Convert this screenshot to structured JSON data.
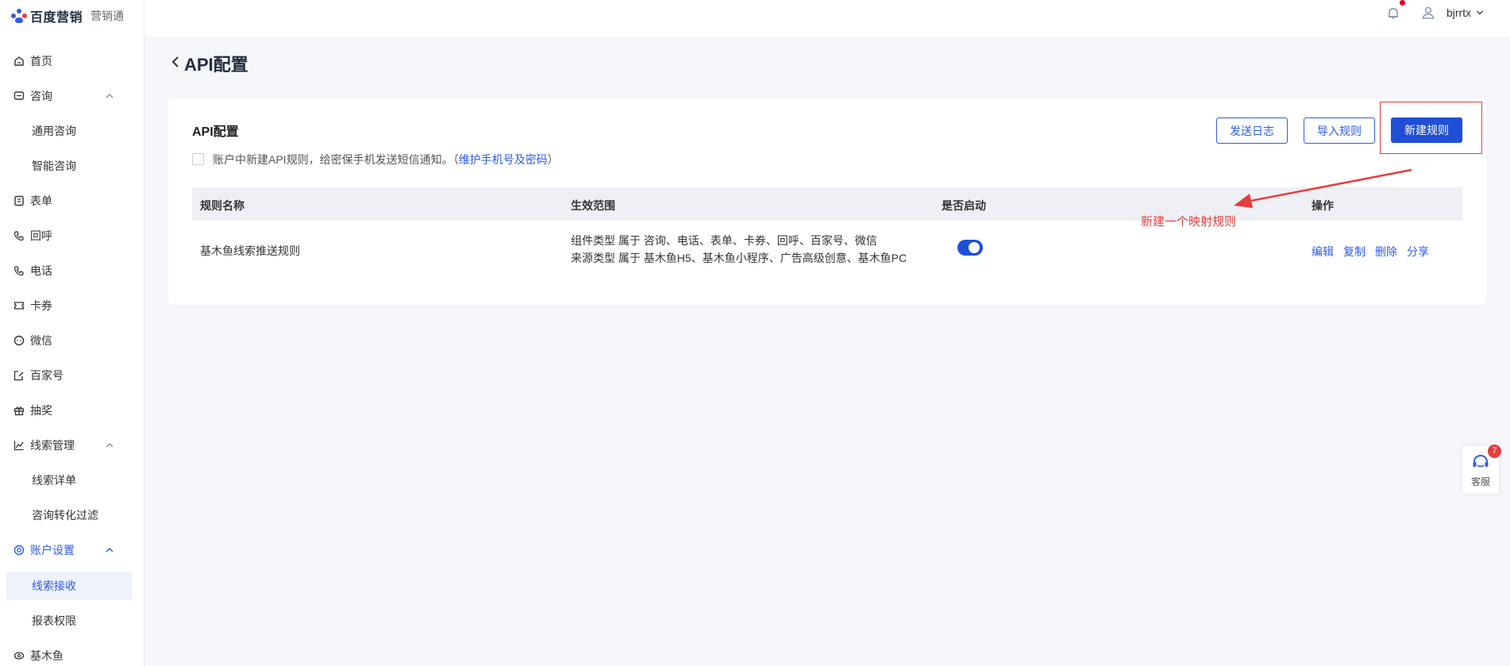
{
  "brand": {
    "name": "百度营销",
    "product": "营销通"
  },
  "topbar": {
    "username": "bjrrtx"
  },
  "sidebar": {
    "items": [
      {
        "label": "首页"
      },
      {
        "label": "咨询"
      },
      {
        "label": "通用咨询"
      },
      {
        "label": "智能咨询"
      },
      {
        "label": "表单"
      },
      {
        "label": "回呼"
      },
      {
        "label": "电话"
      },
      {
        "label": "卡券"
      },
      {
        "label": "微信"
      },
      {
        "label": "百家号"
      },
      {
        "label": "抽奖"
      },
      {
        "label": "线索管理"
      },
      {
        "label": "线索详单"
      },
      {
        "label": "咨询转化过滤"
      },
      {
        "label": "账户设置"
      },
      {
        "label": "线索接收"
      },
      {
        "label": "报表权限"
      },
      {
        "label": "基木鱼"
      }
    ]
  },
  "page": {
    "title": "API配置"
  },
  "card": {
    "title": "API配置",
    "notice_text": "账户中新建API规则，给密保手机发送短信通知。（",
    "notice_link": "维护手机号及密码",
    "notice_end": "）",
    "buttons": {
      "send_log": "发送日志",
      "import_rule": "导入规则",
      "new_rule": "新建规则"
    },
    "table": {
      "headers": [
        "规则名称",
        "生效范围",
        "是否启动",
        "操作"
      ],
      "rows": [
        {
          "name": "基木鱼线索推送规则",
          "scope_line1": "组件类型  属于  咨询、电话、表单、卡券、回呼、百家号、微信",
          "scope_line2": "来源类型  属于  基木鱼H5、基木鱼小程序、广告高级创意、基木鱼PC",
          "enabled": true,
          "ops": [
            "编辑",
            "复制",
            "删除",
            "分享"
          ]
        }
      ]
    }
  },
  "annotation": {
    "text": "新建一个映射规则"
  },
  "customer_service": {
    "label": "客服",
    "badge": "7"
  },
  "colors": {
    "primary": "#1f4fd6",
    "annotation": "#e53e3e",
    "link": "#2f5be7"
  }
}
